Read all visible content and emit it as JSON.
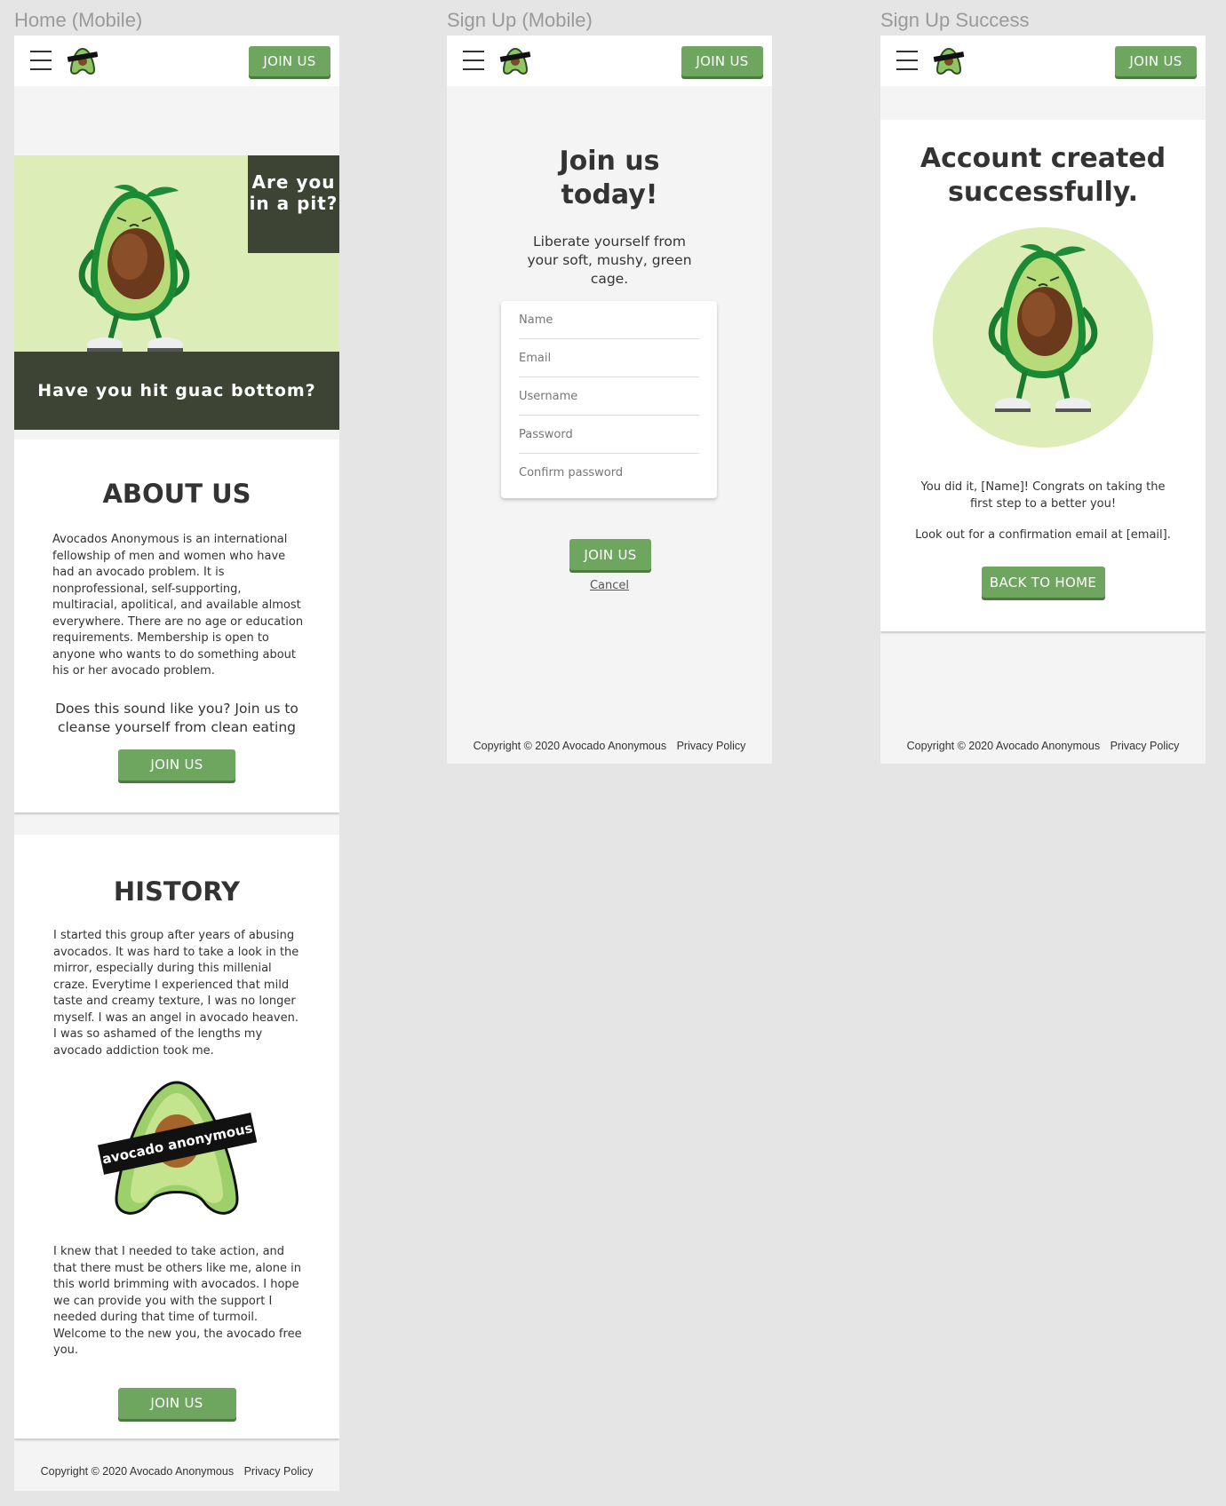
{
  "frames": {
    "home": "Home (Mobile)",
    "signup": "Sign Up (Mobile)",
    "success": "Sign Up Success"
  },
  "nav": {
    "join_label": "JOIN US",
    "menu_icon": "hamburger-icon",
    "logo_icon": "avocado-logo-icon"
  },
  "home": {
    "hero_tag": "Are you in a pit?",
    "hero_band": "Have you hit guac bottom?",
    "about_title": "ABOUT US",
    "about_text": "Avocados Anonymous is an international fellowship of men and women who have had an avocado problem. It is nonprofessional, self-supporting, multiracial, apolitical, and available almost everywhere. There are no age or education requirements. Membership is open to anyone who wants to do something about his or her avocado problem.",
    "about_cta": "Does this sound like you? Join us to cleanse yourself from clean eating",
    "about_button": "JOIN US",
    "history_title": "HISTORY",
    "history_text1": "I started this group after years of abusing avocados. It was hard to take a look in the mirror, especially during this millenial craze. Everytime I experienced that mild taste and creamy texture, I was no longer myself. I was an angel in avocado heaven. I was so ashamed of the lengths my avocado addiction took me.",
    "badge_text": "avocado anonymous",
    "history_text2": "I knew that I needed to take action, and that there must be others like me, alone in this world brimming with avocados. I hope we can provide you with the support I needed during that time of turmoil. Welcome to the new you, the avocado free you.",
    "history_button": "JOIN US"
  },
  "signup": {
    "title": "Join us today!",
    "subtitle": "Liberate yourself from your soft, mushy, green cage.",
    "fields": [
      "Name",
      "Email",
      "Username",
      "Password",
      "Confirm password"
    ],
    "submit": "JOIN US",
    "cancel": "Cancel"
  },
  "success": {
    "title": "Account created successfully.",
    "message": "You did it, [Name]! Congrats on taking the first step to a better you!",
    "email_note": "Look out for a confirmation email at [email].",
    "back_button": "BACK TO HOME"
  },
  "footer": {
    "copyright": "Copyright © 2020 Avocado Anonymous",
    "privacy": "Privacy Policy"
  },
  "colors": {
    "accent": "#6ea660",
    "dark": "#3d4433",
    "hero_bg": "#dcedb7",
    "page_bg": "#e5e5e5"
  }
}
